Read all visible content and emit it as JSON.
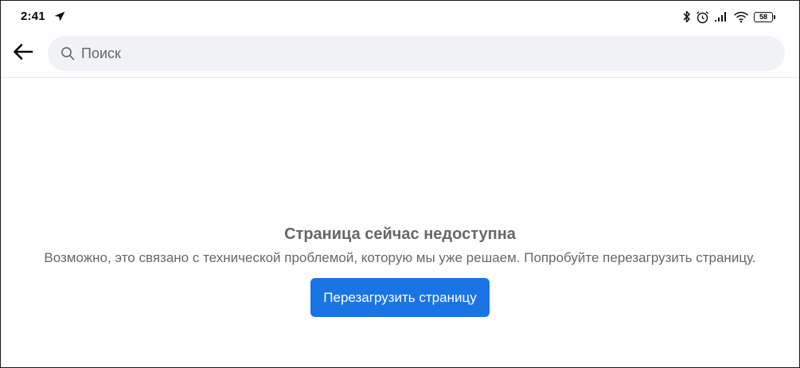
{
  "status_bar": {
    "time": "2:41",
    "battery_level": "58",
    "icons": [
      "navigation-arrow-icon",
      "bluetooth-icon",
      "alarm-icon",
      "signal-icon",
      "wifi-icon",
      "battery-icon"
    ]
  },
  "search": {
    "placeholder": "Поиск",
    "value": ""
  },
  "error": {
    "title": "Страница сейчас недоступна",
    "message": "Возможно, это связано с технической проблемой, которую мы уже решаем. Попробуйте перезагрузить страницу.",
    "button_label": "Перезагрузить страницу"
  },
  "colors": {
    "accent": "#1b74e4",
    "search_bg": "#f0f2f5",
    "secondary_text": "#65676b"
  }
}
